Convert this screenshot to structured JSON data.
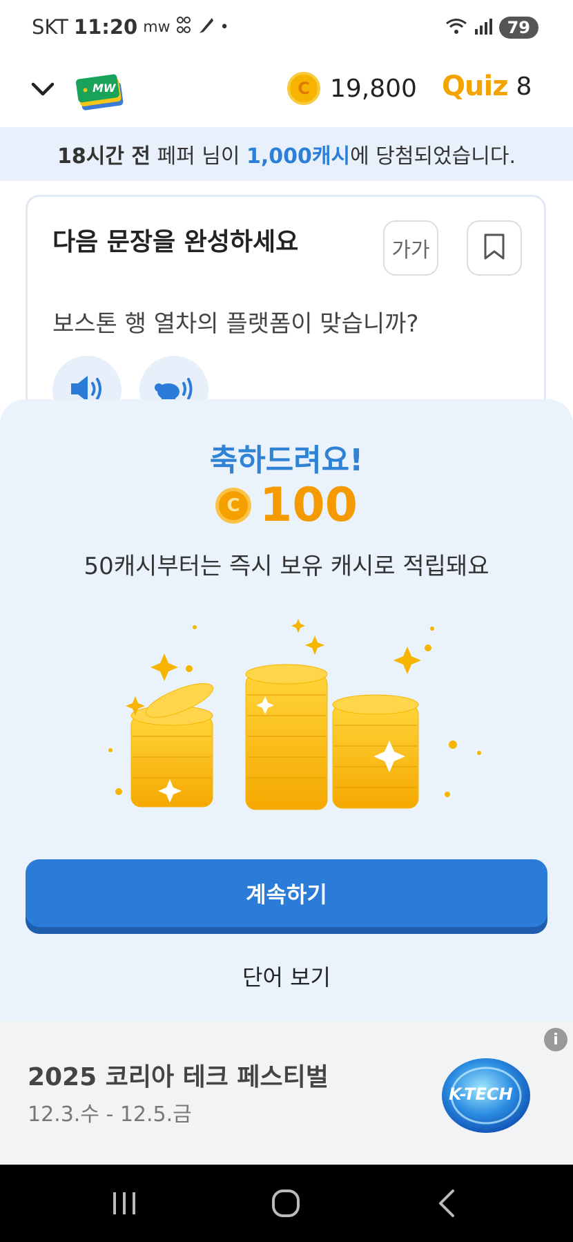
{
  "status_bar": {
    "carrier": "SKT",
    "time": "11:20",
    "notif_icons": [
      "mw",
      "grid",
      "feather",
      "•"
    ],
    "battery": "79"
  },
  "header": {
    "coin_symbol": "C",
    "cash_balance": "19,800",
    "quiz_label": "Quiz",
    "quiz_count": "8",
    "logo_text": "MW"
  },
  "notice": {
    "time_ago": "18시간 전",
    "user_part": " 페퍼 님이 ",
    "amount": "1,000캐시",
    "suffix": "에 당첨되었습니다."
  },
  "question_card": {
    "title": "다음 문장을 완성하세요",
    "font_size_button": "가가",
    "sentence": "보스톤 행 열차의 플랫폼이 맞습니까?"
  },
  "reward_sheet": {
    "title": "축하드려요!",
    "coin_symbol": "C",
    "amount": "100",
    "description": "50캐시부터는 즉시 보유 캐시로 적립돼요",
    "continue_label": "계속하기",
    "view_words_label": "단어 보기"
  },
  "ad": {
    "title": "2025 코리아 테크 페스티벌",
    "date": "12.3.수 - 12.5.금",
    "info_symbol": "i",
    "logo_text": "K-TECH"
  },
  "colors": {
    "accent_blue": "#2b7bd8",
    "coin_orange": "#f59a00",
    "sheet_bg": "#eaf2fc"
  }
}
